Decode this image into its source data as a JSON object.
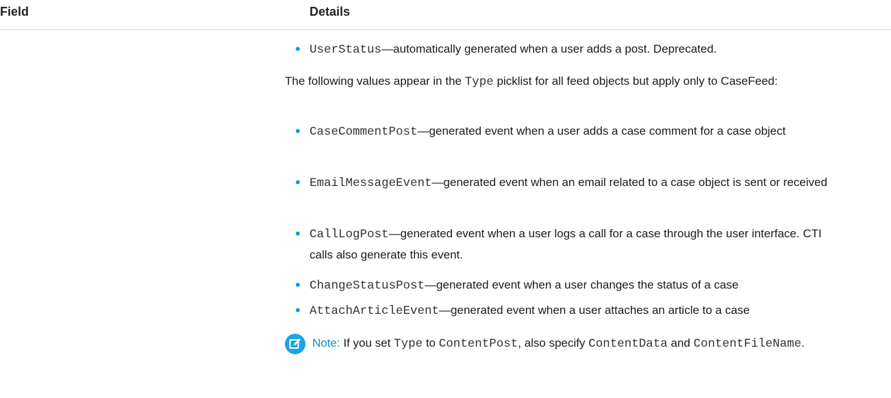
{
  "header": {
    "field_label": "Field",
    "details_label": "Details"
  },
  "items_top": [
    {
      "code": "UserStatus",
      "text": "—automatically generated when a user adds a post. Deprecated."
    }
  ],
  "para1": {
    "before": "The following values appear in the ",
    "code": "Type",
    "after": " picklist for all feed objects but apply only to CaseFeed:"
  },
  "items": [
    {
      "code": "CaseCommentPost",
      "text": "—generated event when a user adds a case comment for a case object"
    },
    {
      "code": "EmailMessageEvent",
      "text": "—generated event when an email related to a case object is sent or received"
    },
    {
      "code": "CallLogPost",
      "text": "—generated event when a user logs a call for a case through the user interface. CTI calls also generate this event."
    },
    {
      "code": "ChangeStatusPost",
      "text": "—generated event when a user changes the status of a case"
    },
    {
      "code": "AttachArticleEvent",
      "text": "—generated event when a user attaches an article to a case"
    }
  ],
  "note": {
    "icon": "edit-note-icon",
    "label": "Note:",
    "t1": " If you set ",
    "c1": "Type",
    "t2": " to ",
    "c2": "ContentPost",
    "t3": ", also specify ",
    "c3": "ContentData",
    "t4": " and ",
    "c4": "ContentFileName",
    "t5": "."
  },
  "colors": {
    "bullet": "#0d9dda",
    "note_icon": "#1da4e6",
    "note_label": "#0d8ecf"
  }
}
